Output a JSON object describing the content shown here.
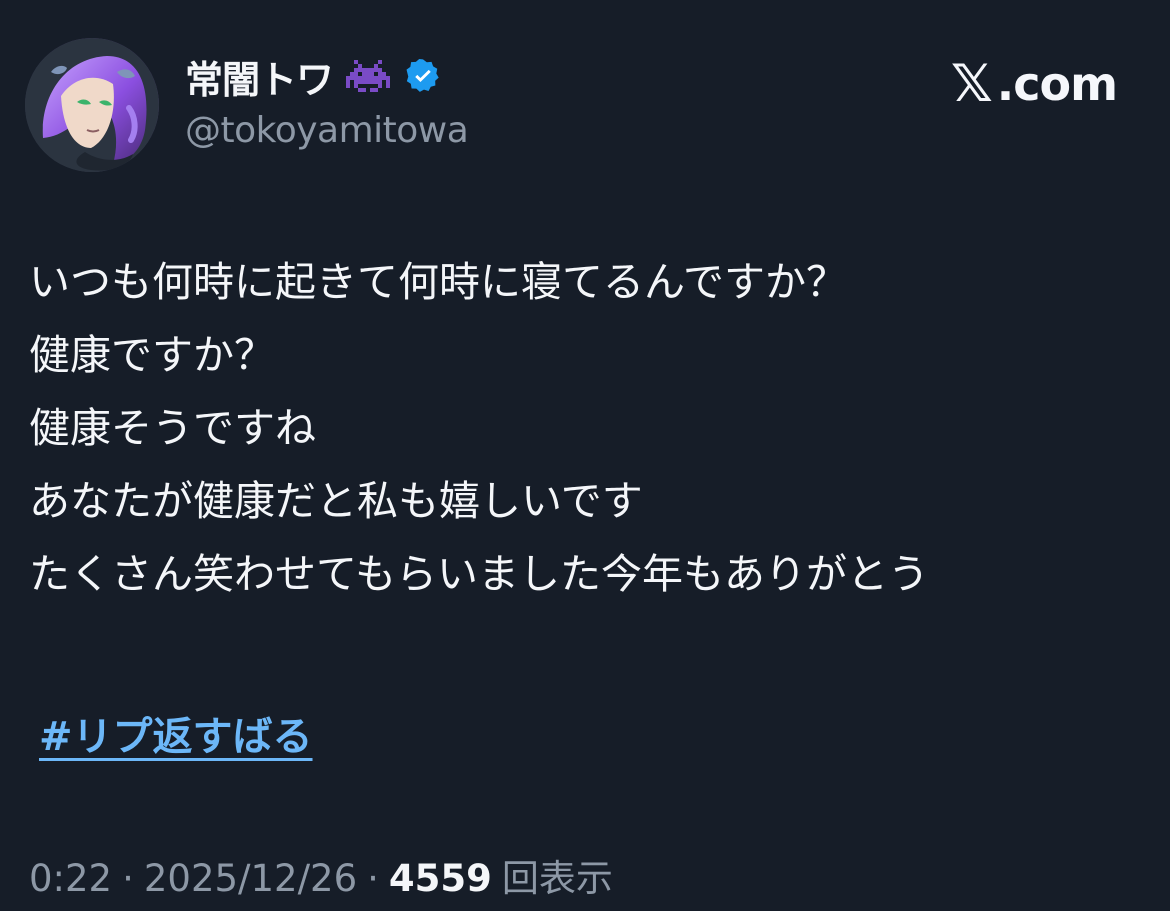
{
  "profile": {
    "display_name": "常闇トワ",
    "handle": "@tokoyamitowa",
    "emoji_icon": "space-invader-icon",
    "verified_icon": "verified-badge-icon"
  },
  "brand": {
    "mark": "𝕏",
    "text": ".com"
  },
  "post": {
    "lines": [
      "いつも何時に起きて何時に寝てるんですか？",
      "健康ですか？",
      "健康そうですね",
      "あなたが健康だと私も嬉しいです",
      "たくさん笑わせてもらいました今年もありがとう"
    ],
    "hashtag": "#リプ返すばる"
  },
  "meta": {
    "time": "0:22",
    "date": "2025/12/26",
    "views_count": "4559",
    "views_label": "回表示",
    "separator": "·"
  },
  "colors": {
    "background": "#161d28",
    "text": "#f4f6f9",
    "muted": "#8d98a6",
    "link": "#6cb7f8",
    "verified": "#1d9bf0",
    "emoji": "#7a4bc6"
  }
}
